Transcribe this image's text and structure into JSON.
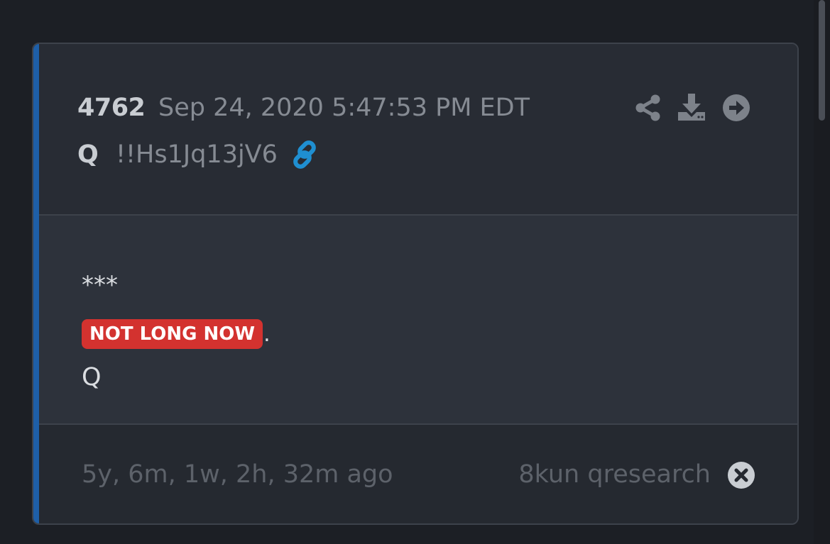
{
  "post": {
    "number": "4762",
    "date": "Sep 24, 2020 5:47:53 PM EDT",
    "author": "Q",
    "tripcode": "!!Hs1Jq13jV6"
  },
  "actions": {
    "share_icon": "share-icon",
    "download_icon": "download-icon",
    "open_icon": "arrow-circle-right-icon",
    "link_icon": "link-icon"
  },
  "content": {
    "line1": "***",
    "badge": "NOT LONG NOW",
    "badge_suffix": ".",
    "signature": "Q"
  },
  "footer": {
    "age": "5y, 6m, 1w, 2h, 32m ago",
    "board": "8kun qresearch",
    "close_icon": "close-circle-icon"
  },
  "colors": {
    "accent": "#1e5fa8",
    "badge": "#d3322f",
    "link": "#1f8fd1",
    "background": "#1c1f25"
  }
}
